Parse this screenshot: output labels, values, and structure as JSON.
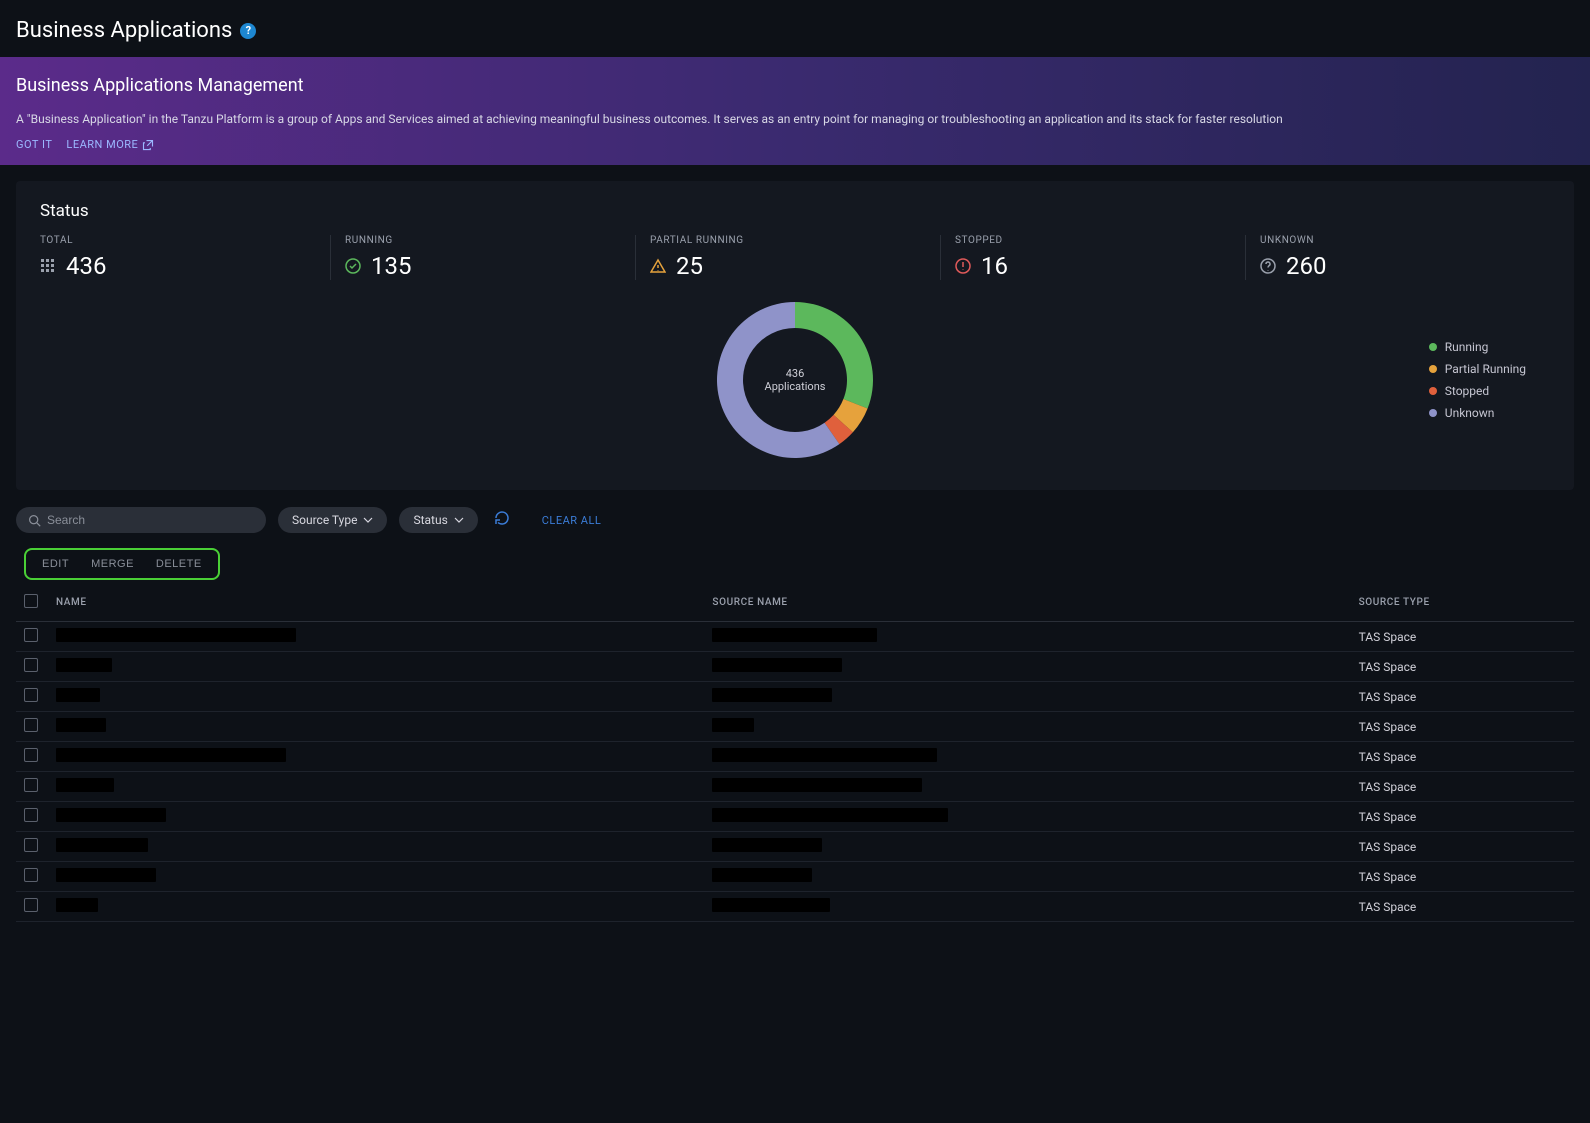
{
  "header": {
    "title": "Business Applications"
  },
  "banner": {
    "title": "Business Applications Management",
    "description": "A \"Business Application\" in the Tanzu Platform is a group of Apps and Services aimed at achieving meaningful business outcomes. It serves as an entry point for managing or troubleshooting an application and its stack for faster resolution",
    "got_it": "GOT IT",
    "learn_more": "LEARN MORE"
  },
  "status": {
    "title": "Status",
    "items": [
      {
        "label": "TOTAL",
        "value": "436",
        "icon": "grid",
        "color": "#9aa0ac"
      },
      {
        "label": "RUNNING",
        "value": "135",
        "icon": "check",
        "color": "#5cb85c"
      },
      {
        "label": "PARTIAL RUNNING",
        "value": "25",
        "icon": "warn",
        "color": "#e6a23c"
      },
      {
        "label": "STOPPED",
        "value": "16",
        "icon": "alert",
        "color": "#e05a5a"
      },
      {
        "label": "UNKNOWN",
        "value": "260",
        "icon": "question",
        "color": "#9aa0ac"
      }
    ],
    "donut_center": "436 Applications",
    "legend": [
      {
        "label": "Running",
        "color": "#5cb85c"
      },
      {
        "label": "Partial Running",
        "color": "#e6a23c"
      },
      {
        "label": "Stopped",
        "color": "#e0603c"
      },
      {
        "label": "Unknown",
        "color": "#8f93c9"
      }
    ]
  },
  "chart_data": {
    "type": "pie",
    "title": "436 Applications",
    "series": [
      {
        "name": "Running",
        "value": 135,
        "color": "#5cb85c"
      },
      {
        "name": "Partial Running",
        "value": 25,
        "color": "#e6a23c"
      },
      {
        "name": "Stopped",
        "value": 16,
        "color": "#e0603c"
      },
      {
        "name": "Unknown",
        "value": 260,
        "color": "#8f93c9"
      }
    ],
    "total": 436
  },
  "toolbar": {
    "search_placeholder": "Search",
    "filter_source": "Source Type",
    "filter_status": "Status",
    "clear_all": "CLEAR ALL"
  },
  "actions": {
    "edit": "EDIT",
    "merge": "MERGE",
    "delete": "DELETE"
  },
  "table": {
    "columns": [
      "NAME",
      "SOURCE NAME",
      "SOURCE TYPE"
    ],
    "rows": [
      {
        "name_w": 240,
        "src_w": 165,
        "source_type": "TAS Space"
      },
      {
        "name_w": 56,
        "src_w": 130,
        "source_type": "TAS Space"
      },
      {
        "name_w": 44,
        "src_w": 120,
        "source_type": "TAS Space"
      },
      {
        "name_w": 50,
        "src_w": 42,
        "source_type": "TAS Space"
      },
      {
        "name_w": 230,
        "src_w": 225,
        "source_type": "TAS Space"
      },
      {
        "name_w": 58,
        "src_w": 210,
        "source_type": "TAS Space"
      },
      {
        "name_w": 110,
        "src_w": 236,
        "source_type": "TAS Space"
      },
      {
        "name_w": 92,
        "src_w": 110,
        "source_type": "TAS Space"
      },
      {
        "name_w": 100,
        "src_w": 100,
        "source_type": "TAS Space"
      },
      {
        "name_w": 42,
        "src_w": 118,
        "source_type": "TAS Space"
      }
    ]
  }
}
